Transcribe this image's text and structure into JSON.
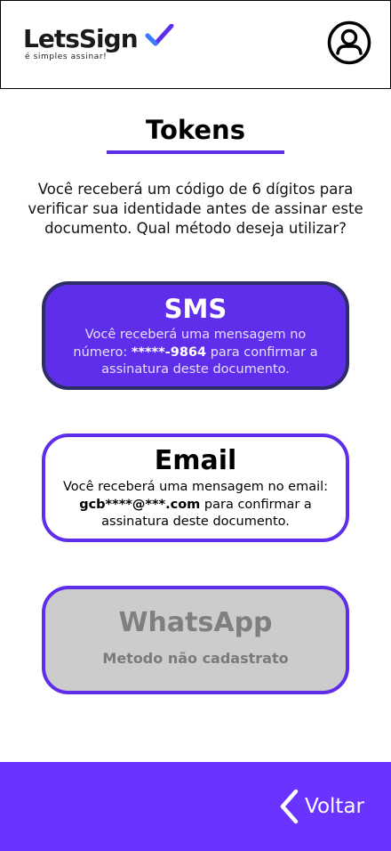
{
  "header": {
    "logo_text": "LetsSign",
    "logo_tagline": "é simples assinar!",
    "profile_icon": "user-circle-icon"
  },
  "page": {
    "title": "Tokens",
    "intro": "Você receberá um código de 6 dígitos para verificar sua identidade antes de assinar este documento. Qual método deseja utilizar?"
  },
  "options": {
    "sms": {
      "title": "SMS",
      "desc_prefix": "Você receberá uma mensagem no número: ",
      "masked_value": "*****-9864",
      "desc_suffix": " para confirmar a assinatura deste documento."
    },
    "email": {
      "title": "Email",
      "desc_prefix": "Você receberá uma mensagem no email: ",
      "masked_value": "gcb****@***.com",
      "desc_suffix": " para confirmar a assinatura deste documento."
    },
    "whatsapp": {
      "title": "WhatsApp",
      "status": "Metodo não cadastrato"
    }
  },
  "footer": {
    "back_label": "Voltar",
    "back_icon": "chevron-left-icon"
  },
  "colors": {
    "accent": "#5f2eea",
    "footer": "#6a33ff",
    "sms_border": "#2e2e66",
    "disabled_bg": "#cccccc"
  }
}
